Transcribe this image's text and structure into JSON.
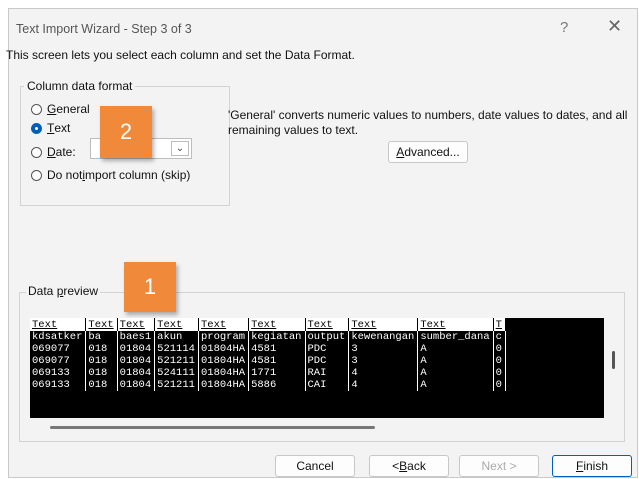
{
  "window": {
    "title": "Text Import Wizard - Step 3 of 3",
    "help": "?",
    "close": "✕"
  },
  "intro": "This screen lets you select each column and set the Data Format.",
  "format": {
    "group_label": "Column data format",
    "options": [
      {
        "pre": "",
        "key": "G",
        "post": "eneral",
        "selected": false
      },
      {
        "pre": "",
        "key": "T",
        "post": "ext",
        "selected": true
      },
      {
        "pre": "",
        "key": "D",
        "post": "ate:",
        "selected": false
      },
      {
        "pre": "Do not ",
        "key": "i",
        "post": "mport column (skip)",
        "selected": false
      }
    ],
    "date_value": ""
  },
  "description": "'General' converts numeric values to numbers, date values to dates, and all remaining values to text.",
  "advanced": {
    "key": "A",
    "post": "dvanced..."
  },
  "preview": {
    "label_pre": "Data ",
    "label_key": "p",
    "label_post": "review",
    "headers": [
      "Text",
      "Text",
      "Text",
      "Text",
      "Text",
      "Text",
      "Text",
      "Text",
      "Text",
      "T"
    ],
    "rows": [
      [
        "kdsatker",
        "ba",
        "baes1",
        "akun",
        "program",
        "kegiatan",
        "output",
        "kewenangan",
        "sumber_dana",
        "c"
      ],
      [
        "069077",
        "018",
        "01804",
        "521114",
        "01804HA",
        "4581",
        "PDC",
        "3",
        "A",
        "0"
      ],
      [
        "069077",
        "018",
        "01804",
        "521211",
        "01804HA",
        "4581",
        "PDC",
        "3",
        "A",
        "0"
      ],
      [
        "069133",
        "018",
        "01804",
        "524111",
        "01804HA",
        "1771",
        "RAI",
        "4",
        "A",
        "0"
      ],
      [
        "069133",
        "018",
        "01804",
        "521211",
        "01804HA",
        "5886",
        "CAI",
        "4",
        "A",
        "0"
      ]
    ]
  },
  "badges": {
    "one": "1",
    "two": "2",
    "color": "#f08a3a"
  },
  "buttons": {
    "cancel": "Cancel",
    "back_pre": "< ",
    "back_key": "B",
    "back_post": "ack",
    "next": "Next >",
    "finish_key": "F",
    "finish_post": "inish"
  },
  "accent": "#005fb8"
}
